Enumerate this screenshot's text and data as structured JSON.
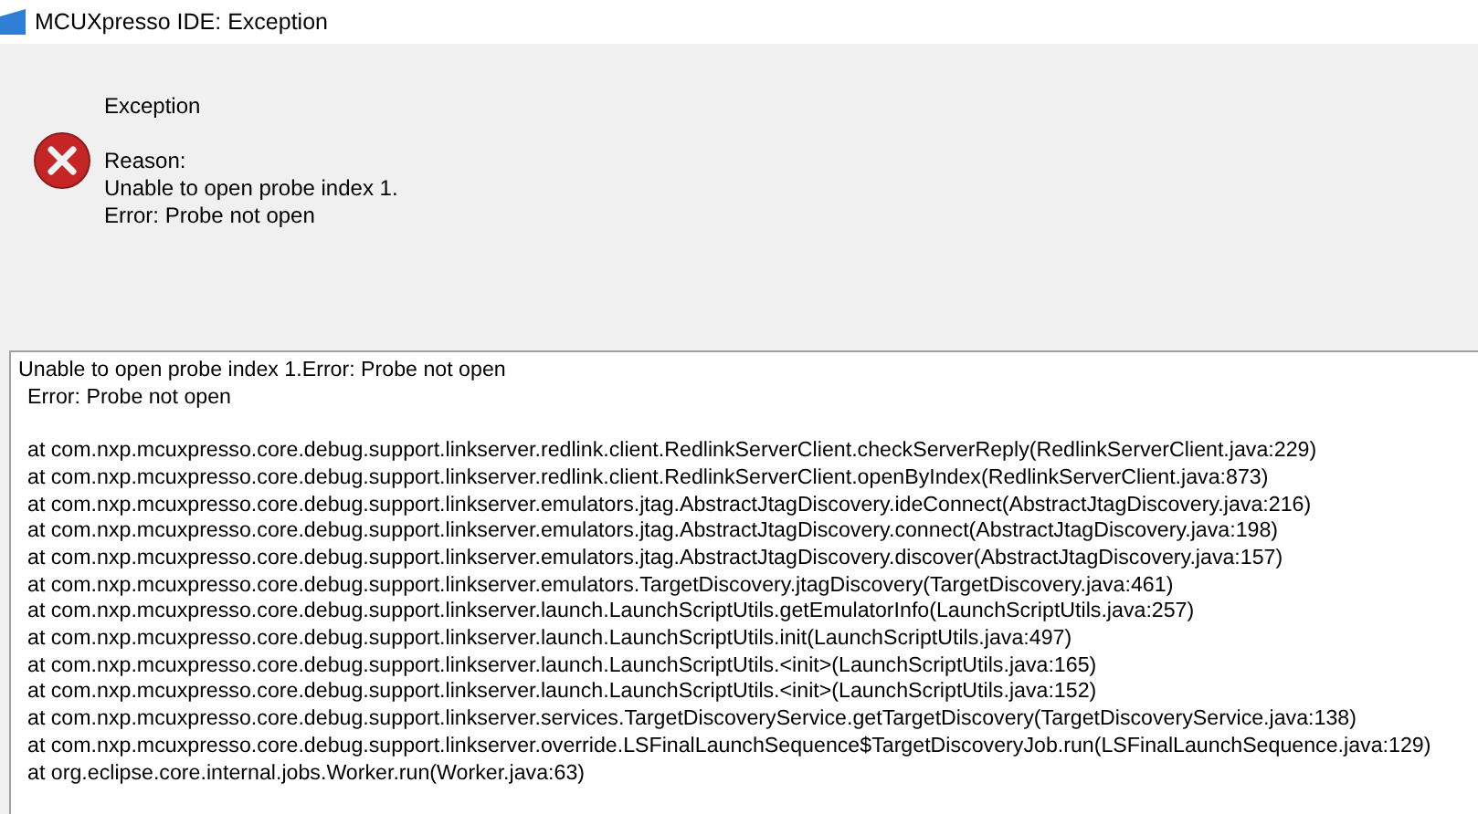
{
  "window": {
    "title": "MCUXpresso IDE: Exception"
  },
  "message": {
    "heading": "Exception",
    "reason_label": "Reason:",
    "lines": [
      "Unable to open probe index 1.",
      "Error: Probe not open"
    ]
  },
  "details": {
    "summary": "Unable to open probe index 1.Error: Probe not open",
    "cause": "Error: Probe not open",
    "stack": [
      "at com.nxp.mcuxpresso.core.debug.support.linkserver.redlink.client.RedlinkServerClient.checkServerReply(RedlinkServerClient.java:229)",
      "at com.nxp.mcuxpresso.core.debug.support.linkserver.redlink.client.RedlinkServerClient.openByIndex(RedlinkServerClient.java:873)",
      "at com.nxp.mcuxpresso.core.debug.support.linkserver.emulators.jtag.AbstractJtagDiscovery.ideConnect(AbstractJtagDiscovery.java:216)",
      "at com.nxp.mcuxpresso.core.debug.support.linkserver.emulators.jtag.AbstractJtagDiscovery.connect(AbstractJtagDiscovery.java:198)",
      "at com.nxp.mcuxpresso.core.debug.support.linkserver.emulators.jtag.AbstractJtagDiscovery.discover(AbstractJtagDiscovery.java:157)",
      "at com.nxp.mcuxpresso.core.debug.support.linkserver.emulators.TargetDiscovery.jtagDiscovery(TargetDiscovery.java:461)",
      "at com.nxp.mcuxpresso.core.debug.support.linkserver.launch.LaunchScriptUtils.getEmulatorInfo(LaunchScriptUtils.java:257)",
      "at com.nxp.mcuxpresso.core.debug.support.linkserver.launch.LaunchScriptUtils.init(LaunchScriptUtils.java:497)",
      "at com.nxp.mcuxpresso.core.debug.support.linkserver.launch.LaunchScriptUtils.<init>(LaunchScriptUtils.java:165)",
      "at com.nxp.mcuxpresso.core.debug.support.linkserver.launch.LaunchScriptUtils.<init>(LaunchScriptUtils.java:152)",
      "at com.nxp.mcuxpresso.core.debug.support.linkserver.services.TargetDiscoveryService.getTargetDiscovery(TargetDiscoveryService.java:138)",
      "at com.nxp.mcuxpresso.core.debug.support.linkserver.override.LSFinalLaunchSequence$TargetDiscoveryJob.run(LSFinalLaunchSequence.java:129)",
      "at org.eclipse.core.internal.jobs.Worker.run(Worker.java:63)"
    ]
  }
}
